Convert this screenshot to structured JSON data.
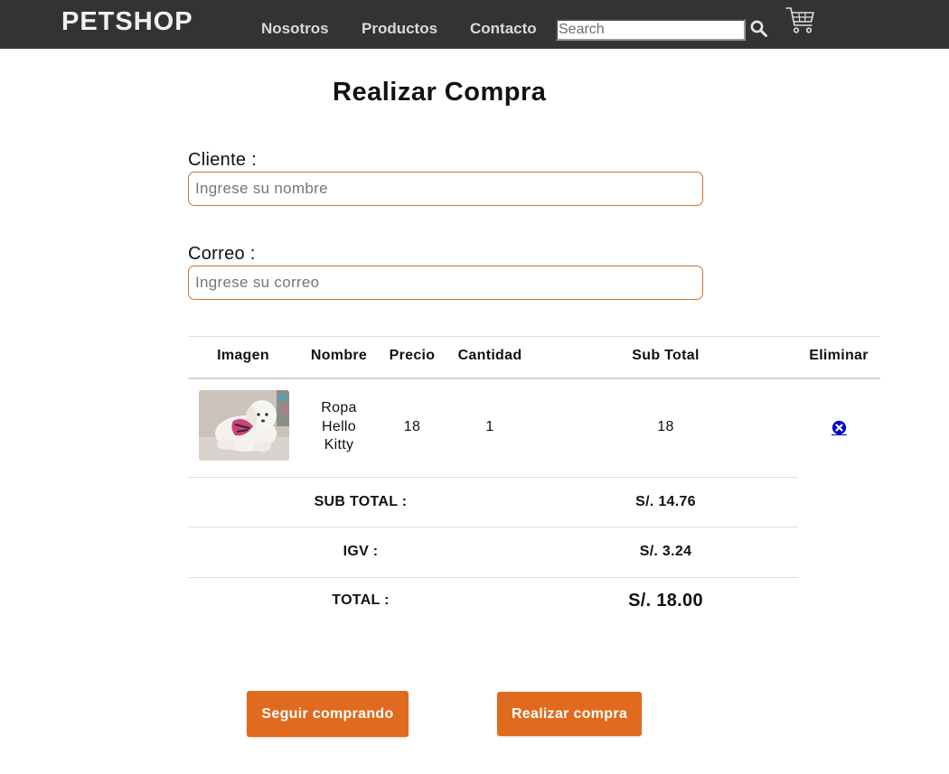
{
  "navbar": {
    "brand": "PETSHOP",
    "links": [
      "Nosotros",
      "Productos",
      "Contacto"
    ],
    "search_placeholder": "Search"
  },
  "page": {
    "title": "Realizar Compra"
  },
  "form": {
    "client": {
      "label": "Cliente :",
      "placeholder": "Ingrese su nombre",
      "value": ""
    },
    "email": {
      "label": "Correo :",
      "placeholder": "Ingrese su correo",
      "value": ""
    }
  },
  "cart_table": {
    "headers": [
      "Imagen",
      "Nombre",
      "Precio",
      "Cantidad",
      "Sub Total",
      "Eliminar"
    ],
    "rows": [
      {
        "image": "white-dog-pink-clothes",
        "name_lines": [
          "Ropa",
          "Hello",
          "Kitty"
        ],
        "price": "18",
        "quantity": "1",
        "subtotal": "18"
      }
    ]
  },
  "totals": {
    "subtotal": {
      "label": "SUB TOTAL :",
      "value": "S/. 14.76"
    },
    "igv": {
      "label": "IGV :",
      "value": "S/. 3.24"
    },
    "total": {
      "label": "TOTAL :",
      "value": "S/. 18.00"
    }
  },
  "buttons": {
    "continue_shopping": "Seguir comprando",
    "place_order": "Realizar compra"
  },
  "icons": {
    "search": "search-icon",
    "cart": "cart-icon",
    "delete": "close-circle-icon"
  },
  "colors": {
    "navbar_bg": "#333333",
    "accent": "#e06a1e",
    "field_border": "#c87533",
    "delete_icon": "#0000cc"
  }
}
